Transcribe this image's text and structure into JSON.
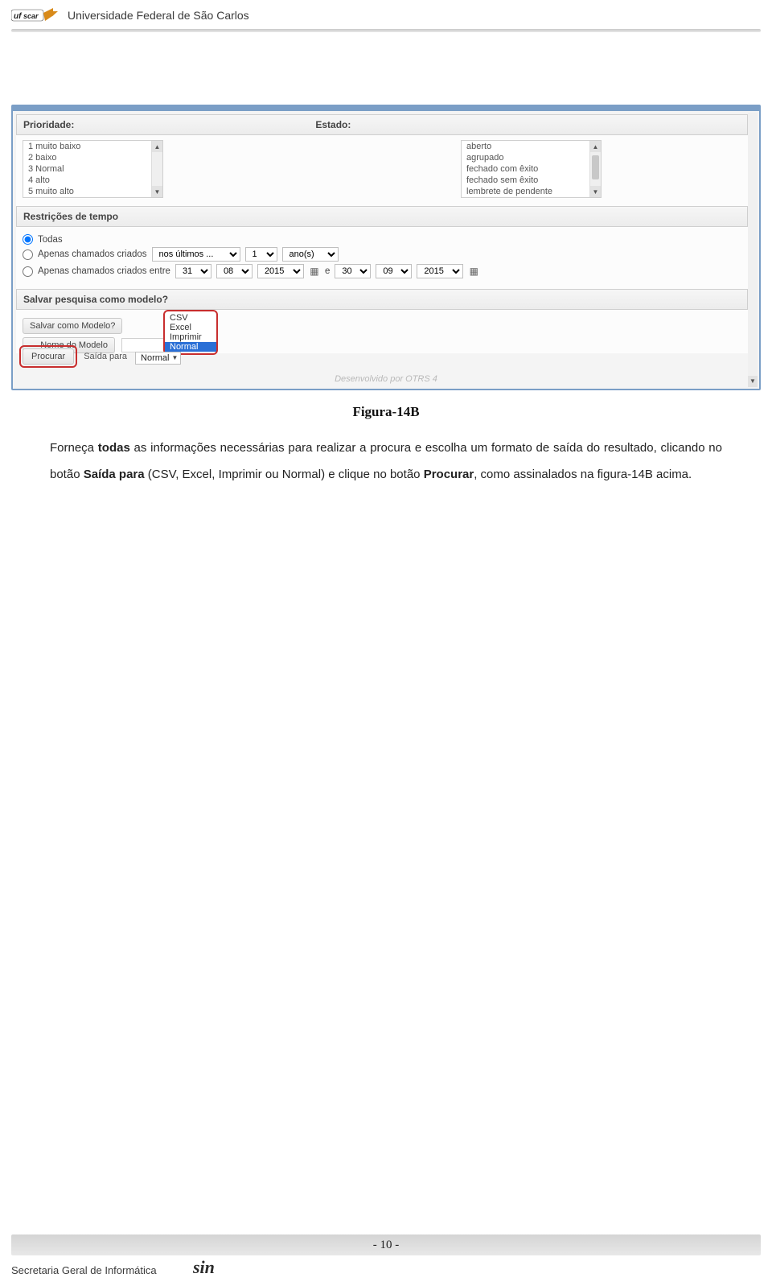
{
  "header": {
    "university": "Universidade Federal de São Carlos"
  },
  "screenshot": {
    "section_prioridade": "Prioridade:",
    "section_estado": "Estado:",
    "prioridade_opts": [
      "1 muito baixo",
      "2 baixo",
      "3 Normal",
      "4 alto",
      "5 muito alto"
    ],
    "estado_opts": [
      "aberto",
      "agrupado",
      "fechado com êxito",
      "fechado sem êxito",
      "lembrete de pendente"
    ],
    "section_restricoes": "Restrições de tempo",
    "radio_todas": "Todas",
    "radio_criados": "Apenas chamados criados",
    "radio_criados_entre": "Apenas chamados criados entre",
    "sel_nos_ultimos": "nos últimos ...",
    "sel_qty": "1",
    "sel_unit": "ano(s)",
    "date_from": {
      "d": "31",
      "m": "08",
      "y": "2015"
    },
    "date_e": "e",
    "date_to": {
      "d": "30",
      "m": "09",
      "y": "2015"
    },
    "section_salvar": "Salvar pesquisa como modelo?",
    "lbl_salvar_como": "Salvar como Modelo?",
    "lbl_nome": "Nome do Modelo",
    "dropdown_opts": [
      "CSV",
      "Excel",
      "Imprimir",
      "Normal"
    ],
    "dropdown_selected": "Normal",
    "btn_procurar": "Procurar",
    "lbl_saida_para": "Saída para",
    "saida_value": "Normal",
    "powered": "Desenvolvido por OTRS 4"
  },
  "figure": {
    "caption": "Figura-14B"
  },
  "paragraph": {
    "p1a": "Forneça ",
    "p1b_bold": "todas",
    "p1c": " as informações necessárias para realizar a procura e escolha um formato de saída do resultado, clicando no botão ",
    "p1d_bold": "Saída para",
    "p1e": " (CSV, Excel, Imprimir ou Normal) e clique no botão ",
    "p1f_bold": "Procurar",
    "p1g": ", como assinalados na figura-14B acima."
  },
  "footer": {
    "page": "- 10 -",
    "org": "Secretaria Geral de Informática",
    "logo": "sin"
  }
}
